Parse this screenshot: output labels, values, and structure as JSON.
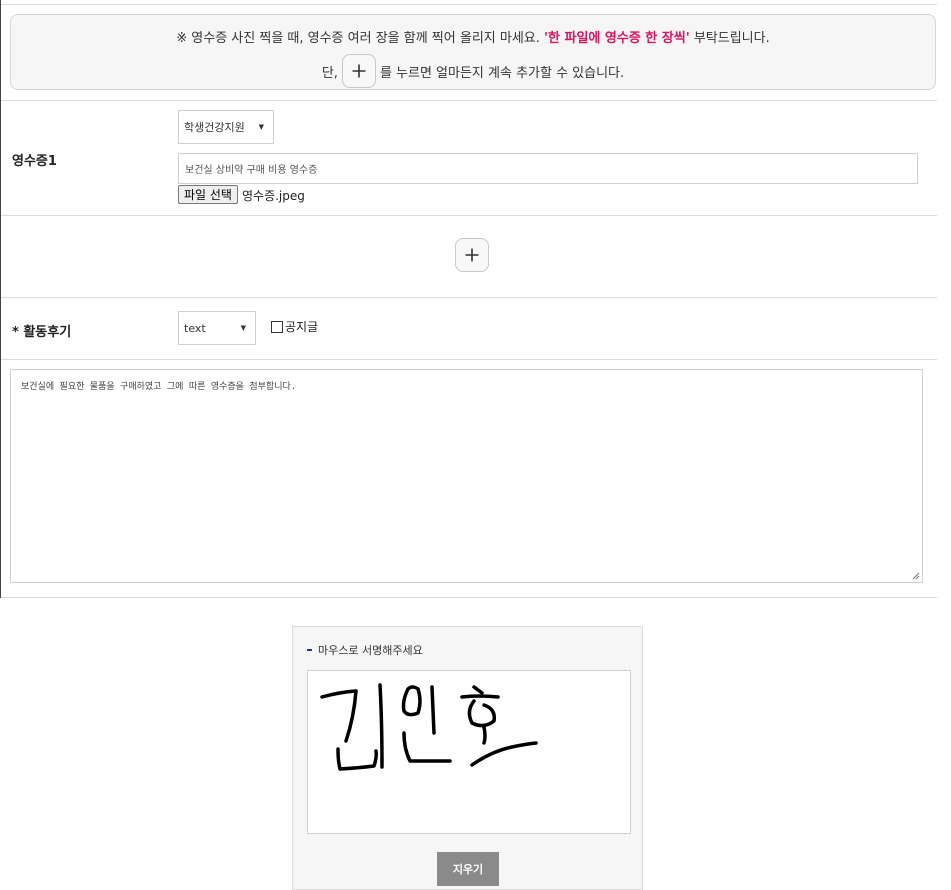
{
  "notice": {
    "line1_prefix": "※ 영수증 사진 찍을 때, 영수증 여러 장을 함께 찍어 올리지 마세요. ",
    "line1_highlight": "'한 파일에 영수증 한 장씩'",
    "line1_suffix": " 부탁드립니다.",
    "line2_prefix": "단,",
    "line2_suffix": "를 누르면 얼마든지 계속 추가할 수 있습니다.",
    "plus_symbol": "+",
    "highlight_color": "#e0115f"
  },
  "receipt": {
    "label": "영수증1",
    "category_select": "학생건강지원",
    "description_value": "보건실 상비약 구매 비용 영수증",
    "file_button_label": "파일 선택",
    "file_name": "영수증.jpeg"
  },
  "add_button": {
    "symbol": "+"
  },
  "review": {
    "label": "* 활동후기",
    "format_select": "text",
    "notice_checkbox_label": "공지글",
    "notice_checked": false,
    "content": "보건실에 필요한 물품을 구매하였고 그에 따른 영수증을 첨부합니다."
  },
  "signature": {
    "title": "마우스로 서명해주세요",
    "clear_button_label": "지우기",
    "stroke_color": "#000000"
  },
  "icons": {
    "select_arrow": "▼",
    "plus": "plus-icon",
    "resize": "resize-grip-icon"
  }
}
